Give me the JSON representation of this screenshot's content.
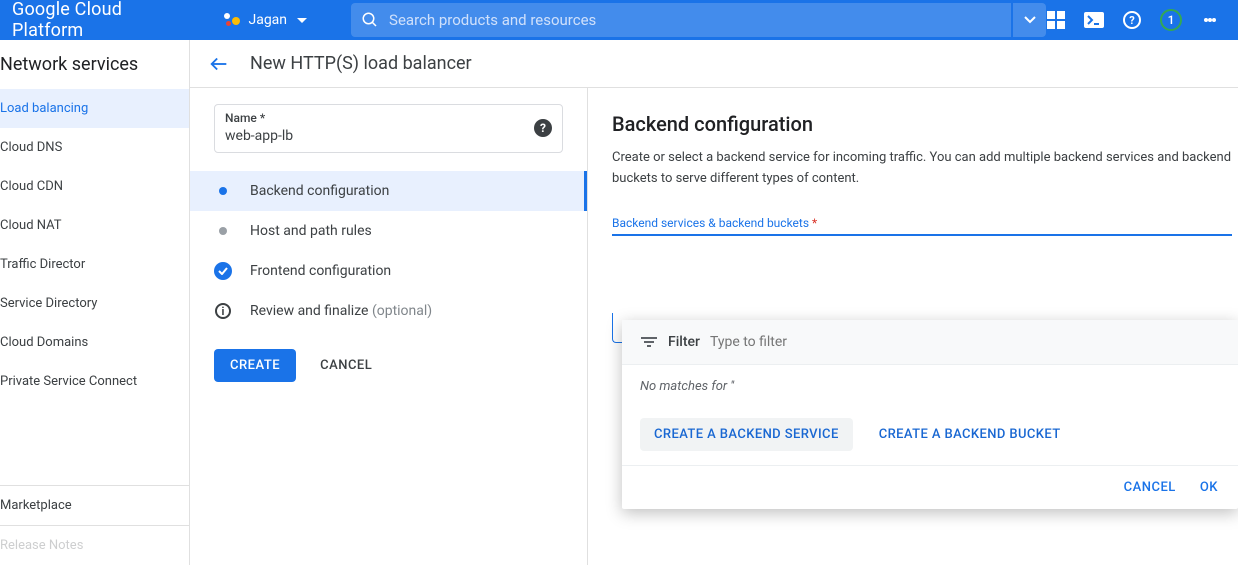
{
  "topbar": {
    "logo": "Google Cloud Platform",
    "project": "Jagan",
    "search_placeholder": "Search products and resources",
    "notif_count": "1"
  },
  "sidebar": {
    "title": "Network services",
    "items": [
      {
        "label": "Load balancing",
        "active": true
      },
      {
        "label": "Cloud DNS"
      },
      {
        "label": "Cloud CDN"
      },
      {
        "label": "Cloud NAT"
      },
      {
        "label": "Traffic Director"
      },
      {
        "label": "Service Directory"
      },
      {
        "label": "Cloud Domains"
      },
      {
        "label": "Private Service Connect"
      }
    ],
    "footer": [
      {
        "label": "Marketplace"
      },
      {
        "label": "Release Notes"
      }
    ]
  },
  "page": {
    "title": "New HTTP(S) load balancer",
    "name_label": "Name",
    "name_value": "web-app-lb",
    "steps": [
      {
        "label": "Backend configuration",
        "state": "active"
      },
      {
        "label": "Host and path rules",
        "state": "pending"
      },
      {
        "label": "Frontend configuration",
        "state": "done"
      },
      {
        "label": "Review and finalize",
        "state": "info",
        "optional": "(optional)"
      }
    ],
    "create": "CREATE",
    "cancel": "CANCEL"
  },
  "right": {
    "title": "Backend configuration",
    "desc": "Create or select a backend service for incoming traffic. You can add multiple backend services and backend buckets to serve different types of content.",
    "dropdown_label": "Backend services & backend buckets",
    "filter_label": "Filter",
    "filter_placeholder": "Type to filter",
    "no_match": "No matches for ''",
    "create_service": "CREATE A BACKEND SERVICE",
    "create_bucket": "CREATE A BACKEND BUCKET",
    "panel_cancel": "CANCEL",
    "panel_ok": "OK"
  }
}
